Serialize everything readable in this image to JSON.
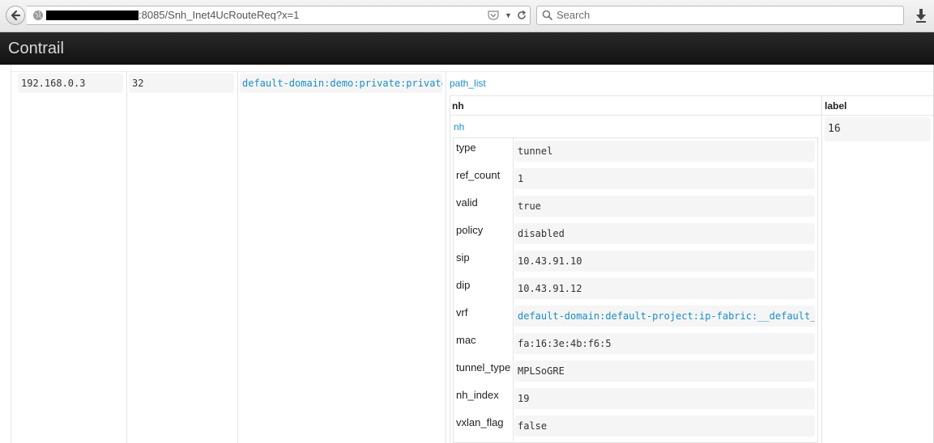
{
  "browser": {
    "url_suffix": ":8085/Snh_Inet4UcRouteReq?x=1",
    "search_placeholder": "Search",
    "icons": [
      "back-arrow-icon",
      "globe-icon",
      "pocket-icon",
      "chevron-down-icon",
      "reload-icon",
      "search-icon",
      "download-icon"
    ]
  },
  "app": {
    "title": "Contrail"
  },
  "route": {
    "src_ip": "192.168.0.3",
    "src_plen": "32",
    "src_vrf": "default-domain:demo:private:private",
    "path_list_link": "path_list",
    "path_table": {
      "nh_header": "nh",
      "label_header": "label",
      "nh_link": "nh",
      "label_value": "16",
      "nh_fields": [
        {
          "key": "type",
          "value": "tunnel"
        },
        {
          "key": "ref_count",
          "value": "1"
        },
        {
          "key": "valid",
          "value": "true"
        },
        {
          "key": "policy",
          "value": "disabled"
        },
        {
          "key": "sip",
          "value": "10.43.91.10"
        },
        {
          "key": "dip",
          "value": "10.43.91.12"
        },
        {
          "key": "vrf",
          "value": "default-domain:default-project:ip-fabric:__default__",
          "is_link": true
        },
        {
          "key": "mac",
          "value": "fa:16:3e:4b:f6:5"
        },
        {
          "key": "tunnel_type",
          "value": "MPLSoGRE"
        },
        {
          "key": "nh_index",
          "value": "19"
        },
        {
          "key": "vxlan_flag",
          "value": "false"
        }
      ]
    }
  },
  "colors": {
    "link": "#1a8ec7",
    "header_bg": "#1a1a1a",
    "cell_bg": "#f5f5f5"
  }
}
